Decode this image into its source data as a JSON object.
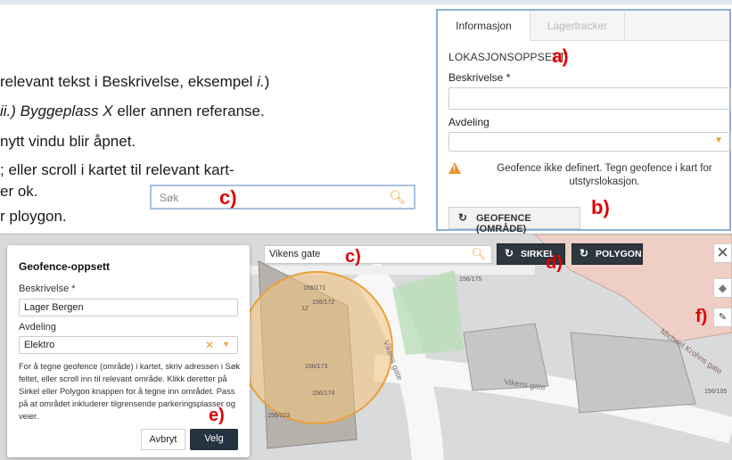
{
  "doc": {
    "line1_a": "relevant tekst i Beskrivelse, eksempel ",
    "line1_b": "i.",
    "line1_c": ")",
    "line2_a": "ii.) Byggeplass X",
    "line2_b": " eller annen referanse.",
    "line3": "nytt vindu blir åpnet.",
    "line4": "; eller scroll i kartet til relevant kart-",
    "line5": "er ok.",
    "line6": "r ploygon."
  },
  "labels": {
    "a": "a)",
    "b": "b)",
    "c": "c)",
    "d": "d)",
    "e": "e)",
    "f": "f)"
  },
  "search_small": {
    "placeholder": "Søk"
  },
  "panel": {
    "tabs": [
      {
        "label": "Informasjon",
        "active": true
      },
      {
        "label": "Lagertracker",
        "active": false
      }
    ],
    "section_title": "LOKASJONSOPPSETT",
    "description_label": "Beskrivelse *",
    "description_value": "",
    "department_label": "Avdeling",
    "department_value": "",
    "warning_text": "Geofence ikke definert. Tegn geofence i kart for utstyrslokasjon.",
    "geofence_button": "GEOFENCE (OMRÅDE)"
  },
  "map": {
    "search_value": "Vikens gate",
    "circle_button": "SIRKEL",
    "polygon_button": "POLYGON",
    "street_labels": [
      "Vikens gate",
      "Vikens gate",
      "Michael Krohns gate"
    ],
    "parcel_labels": [
      "156/171",
      "156/172",
      "156/173",
      "156/174",
      "156/175",
      "156/223",
      "156/105",
      "12"
    ]
  },
  "dialog": {
    "title": "Geofence-oppsett",
    "description_label": "Beskrivelse *",
    "description_value": "Lager Bergen",
    "department_label": "Avdeling",
    "department_value": "Elektro",
    "help_text": "For å tegne geofence (område) i kartet, skriv adressen i Søk feltet, eller scroll inn til relevant område. Klikk deretter på Sirkel eller Polygon knappen for å tegne inn området. Pass på at området inkluderer tilgrensende parkeringsplasser og veier.",
    "cancel_button": "Avbryt",
    "ok_button": "Velg"
  },
  "colors": {
    "accent_orange": "#e9a13b",
    "dark_button": "#2e3740",
    "annotation_red": "#e00000",
    "geofence_fill": "#f5c27a"
  },
  "icons": [
    "search-icon",
    "warning-icon",
    "geofence-icon",
    "close-icon",
    "layers-icon",
    "edit-icon",
    "chevron-down-icon",
    "clear-icon"
  ]
}
